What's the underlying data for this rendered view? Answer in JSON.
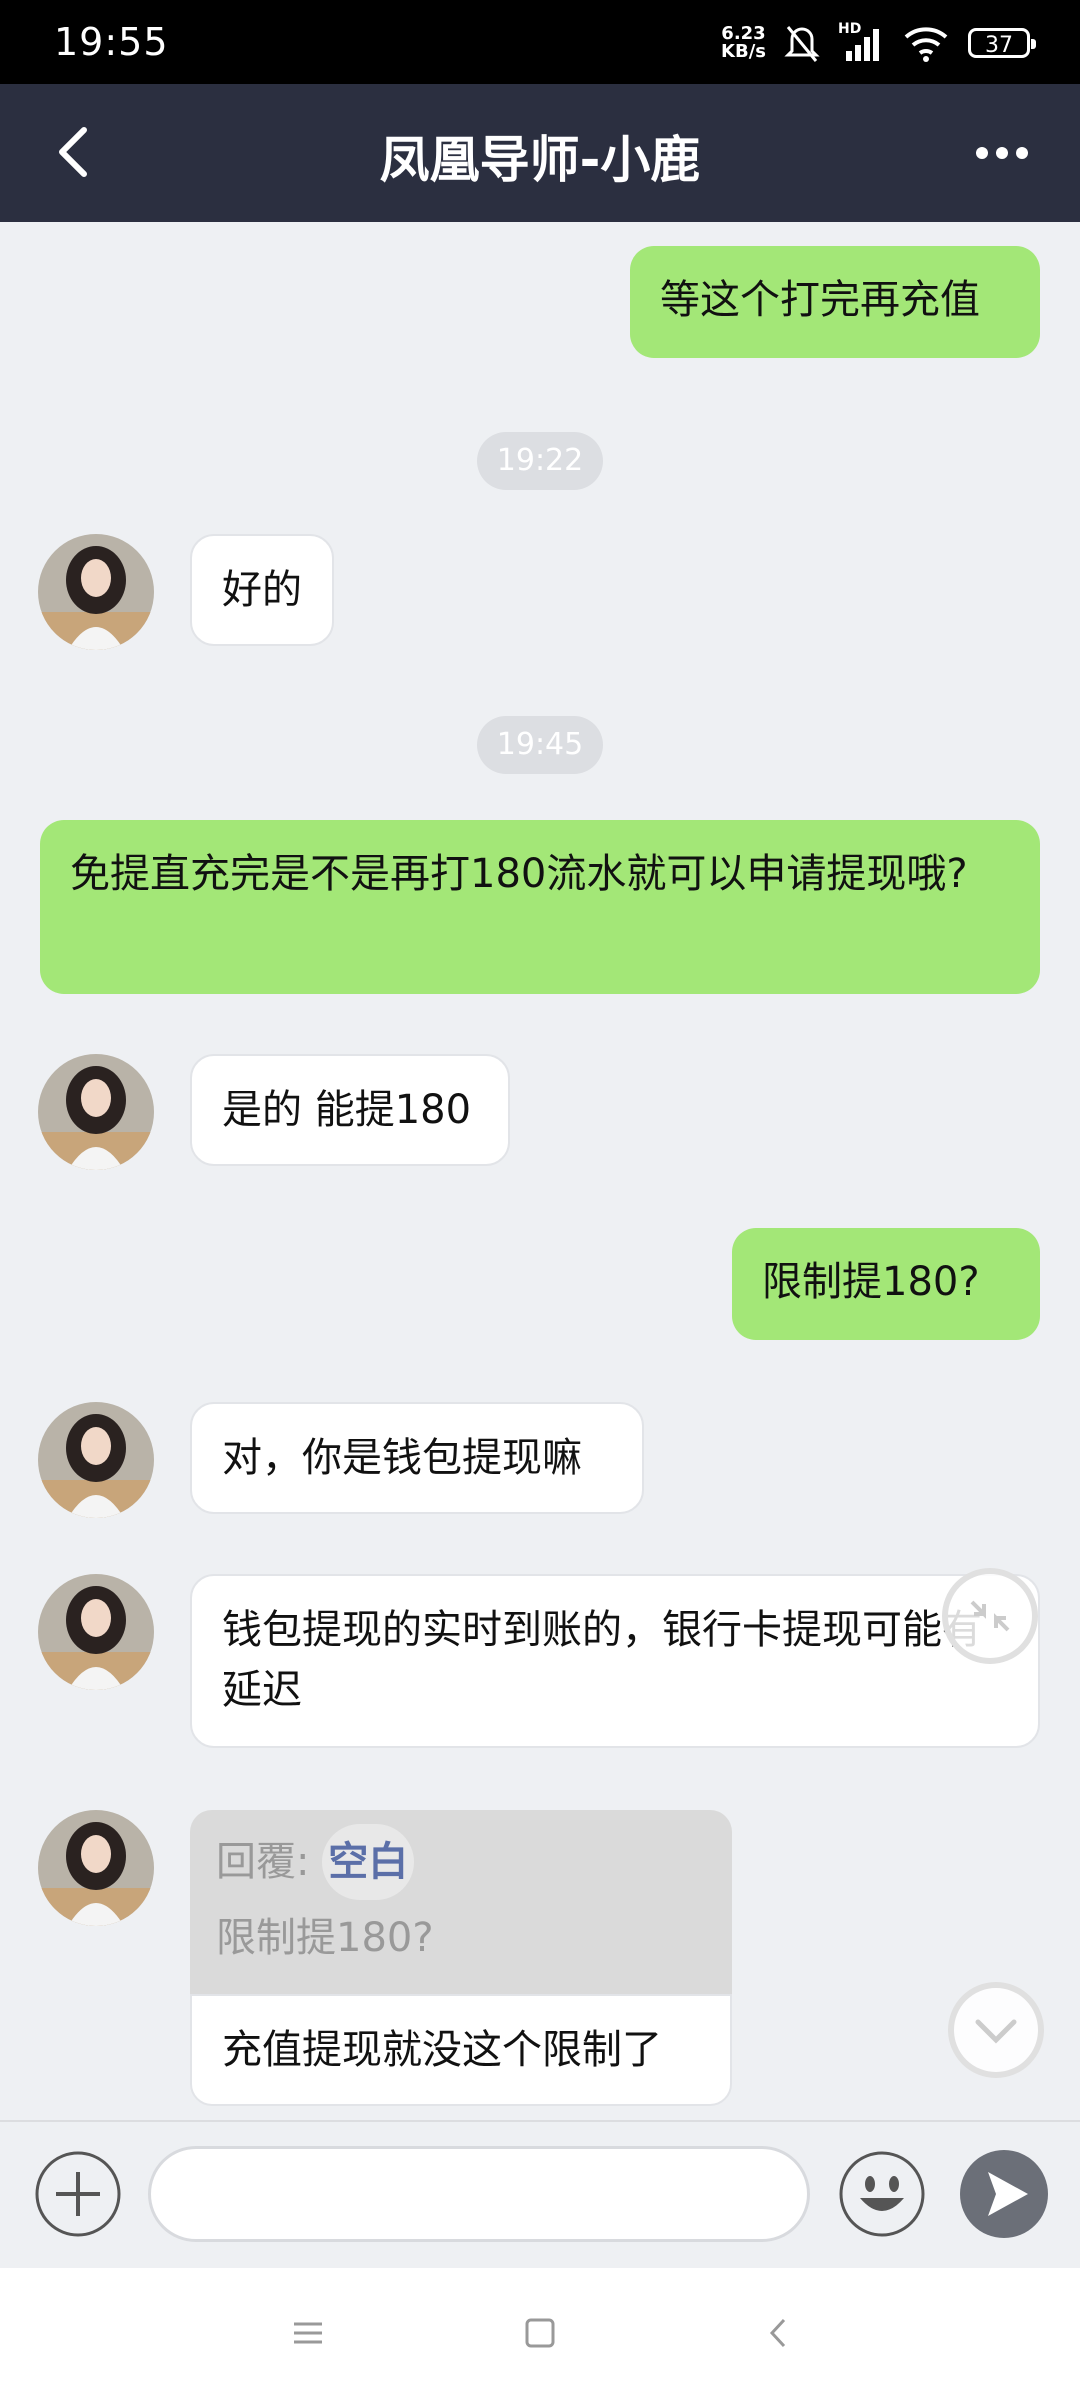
{
  "status_bar": {
    "time": "19:55",
    "net_speed_value": "6.23",
    "net_speed_unit": "KB/s",
    "signal_label": "HD",
    "battery_level": "37"
  },
  "header": {
    "title": "凤凰导师-小鹿"
  },
  "messages": [
    {
      "type": "sent",
      "text": "等这个打完再充值"
    },
    {
      "type": "time",
      "text": "19:22"
    },
    {
      "type": "received",
      "text": "好的"
    },
    {
      "type": "time",
      "text": "19:45"
    },
    {
      "type": "sent",
      "text": "免提直充完是不是再打180流水就可以申请提现哦?"
    },
    {
      "type": "received",
      "text": "是的 能提180"
    },
    {
      "type": "sent",
      "text": "限制提180?"
    },
    {
      "type": "received",
      "text": "对，你是钱包提现嘛"
    },
    {
      "type": "received",
      "text": "钱包提现的实时到账的，银行卡提现可能有延迟"
    },
    {
      "type": "received_reply",
      "quote_prefix": "回覆:",
      "quote_author": "空白",
      "quote_text": "限制提180?",
      "text": "充值提现就没这个限制了"
    }
  ],
  "input": {
    "value": "",
    "placeholder": ""
  },
  "icons": {
    "back": "chevron-left-icon",
    "more": "more-dots-icon",
    "plus": "plus-circle-icon",
    "emoji": "smiley-icon",
    "send": "send-icon",
    "collapse": "collapse-arrows-icon",
    "scroll_down": "chevron-down-icon"
  },
  "colors": {
    "header_bg": "#2b2f40",
    "sent_bubble": "#a3e777",
    "received_bubble": "#ffffff",
    "chat_bg": "#eef0f3"
  }
}
